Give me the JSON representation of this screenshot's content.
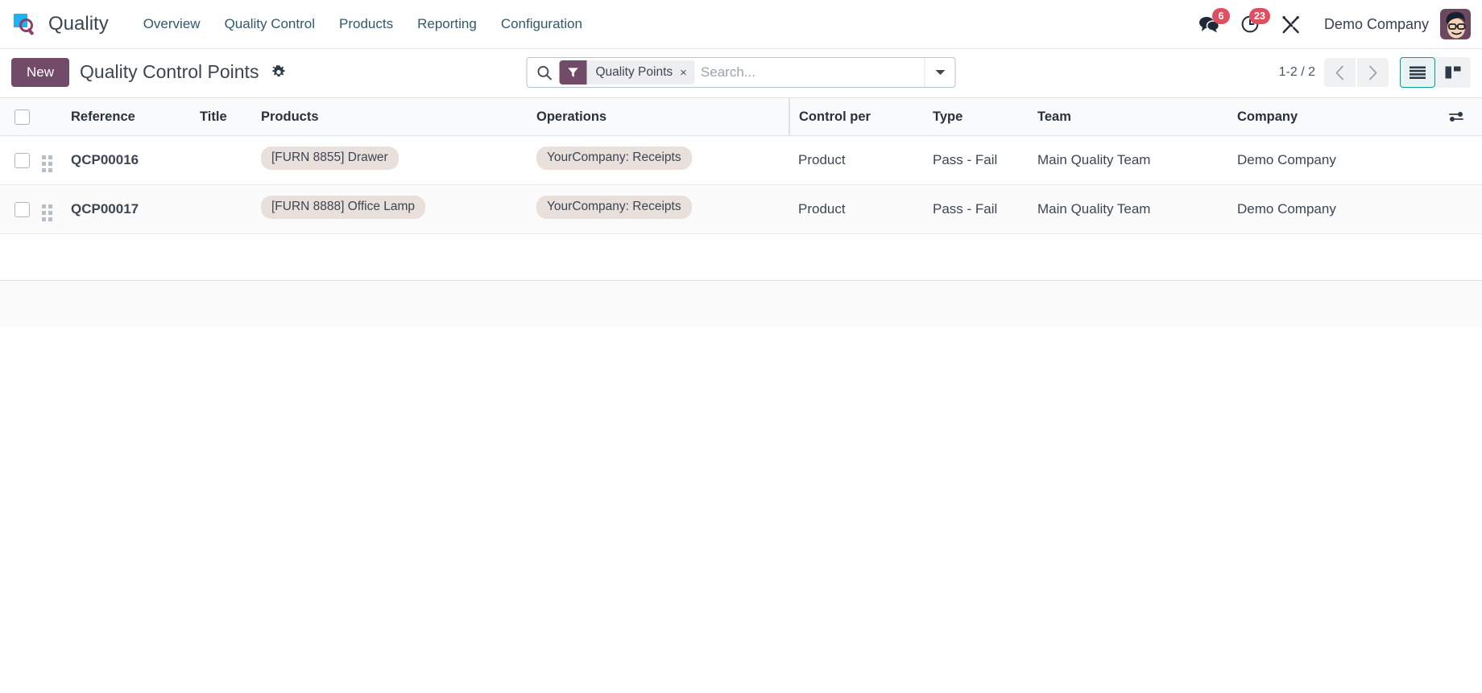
{
  "app": {
    "brand_name": "Quality",
    "logo_icon": "quality-magnifier-logo"
  },
  "navbar": {
    "menu_items": [
      {
        "label": "Overview",
        "name": "overview"
      },
      {
        "label": "Quality Control",
        "name": "quality-control"
      },
      {
        "label": "Products",
        "name": "products"
      },
      {
        "label": "Reporting",
        "name": "reporting"
      },
      {
        "label": "Configuration",
        "name": "configuration"
      }
    ],
    "systray": {
      "messages_icon": "messages-icon",
      "messages_count": "6",
      "activities_icon": "clock-activities-icon",
      "activities_count": "23",
      "debug_icon": "tools-debug-icon",
      "company_name": "Demo Company",
      "avatar_icon": "user-avatar"
    },
    "badge_color": "#e04f5f"
  },
  "control_panel": {
    "new_button": "New",
    "page_title": "Quality Control Points",
    "settings_gear_icon": "gear-icon",
    "accent_color": "#714b67",
    "search": {
      "search_icon": "search-icon",
      "facet_icon": "filter-funnel-icon",
      "facet_label": "Quality Points",
      "facet_remove_icon": "×",
      "placeholder": "Search...",
      "value": "",
      "dropdown_icon": "chevron-down-icon"
    },
    "pager": {
      "range": "1-2 / 2",
      "previous_icon": "chevron-left-icon",
      "next_icon": "chevron-right-icon"
    },
    "view_switcher": {
      "list_icon": "list-view-icon",
      "kanban_icon": "kanban-view-icon",
      "active": "list",
      "active_color": "#00a09d"
    }
  },
  "list": {
    "select_all_checkbox": "",
    "optional_columns_icon": "adjust-sliders-icon",
    "columns": [
      {
        "key": "reference",
        "label": "Reference"
      },
      {
        "key": "title",
        "label": "Title"
      },
      {
        "key": "products",
        "label": "Products"
      },
      {
        "key": "operations",
        "label": "Operations"
      },
      {
        "key": "control_per",
        "label": "Control per"
      },
      {
        "key": "type",
        "label": "Type"
      },
      {
        "key": "team",
        "label": "Team"
      },
      {
        "key": "company",
        "label": "Company"
      }
    ],
    "rows": [
      {
        "reference": "QCP00016",
        "title": "",
        "products": "[FURN  8855] Drawer",
        "operations": "YourCompany: Receipts",
        "control_per": "Product",
        "type": "Pass - Fail",
        "team": "Main Quality Team",
        "company": "Demo Company"
      },
      {
        "reference": "QCP00017",
        "title": "",
        "products": "[FURN  8888] Office Lamp",
        "operations": "YourCompany: Receipts",
        "control_per": "Product",
        "type": "Pass - Fail",
        "team": "Main Quality Team",
        "company": "Demo Company"
      }
    ],
    "tag_background_color": "#e9dfdb"
  }
}
